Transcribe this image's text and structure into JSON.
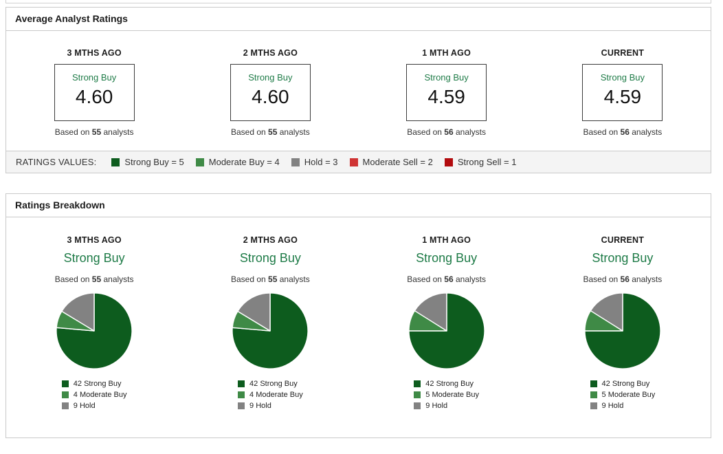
{
  "colors": {
    "strong_buy": "#0d5c1e",
    "moderate_buy": "#3f8a46",
    "hold": "#828282",
    "moderate_sell": "#cf3434",
    "strong_sell": "#b20b0e",
    "consensus_text": "#1e7b47",
    "panel_border": "#c9c9c9",
    "legend_strip_bg": "#f4f4f4"
  },
  "average_ratings": {
    "title": "Average Analyst Ratings",
    "based_prefix": "Based on",
    "based_suffix": "analysts",
    "columns": [
      {
        "period": "3 MTHS AGO",
        "consensus": "Strong Buy",
        "value": "4.60",
        "analysts": "55"
      },
      {
        "period": "2 MTHS AGO",
        "consensus": "Strong Buy",
        "value": "4.60",
        "analysts": "55"
      },
      {
        "period": "1 MTH AGO",
        "consensus": "Strong Buy",
        "value": "4.59",
        "analysts": "56"
      },
      {
        "period": "CURRENT",
        "consensus": "Strong Buy",
        "value": "4.59",
        "analysts": "56"
      }
    ],
    "ratings_values": {
      "label": "RATINGS VALUES:",
      "items": [
        {
          "label": "Strong Buy = 5",
          "color": "#0d5c1e"
        },
        {
          "label": "Moderate Buy = 4",
          "color": "#3f8a46"
        },
        {
          "label": "Hold = 3",
          "color": "#828282"
        },
        {
          "label": "Moderate Sell = 2",
          "color": "#cf3434"
        },
        {
          "label": "Strong Sell = 1",
          "color": "#b20b0e"
        }
      ]
    }
  },
  "ratings_breakdown": {
    "title": "Ratings Breakdown",
    "based_prefix": "Based on",
    "based_suffix": "analysts",
    "columns": [
      {
        "period": "3 MTHS AGO",
        "consensus": "Strong Buy",
        "analysts": "55",
        "legend": [
          {
            "text": "42 Strong Buy",
            "color": "#0d5c1e"
          },
          {
            "text": "4 Moderate Buy",
            "color": "#3f8a46"
          },
          {
            "text": "9 Hold",
            "color": "#828282"
          }
        ]
      },
      {
        "period": "2 MTHS AGO",
        "consensus": "Strong Buy",
        "analysts": "55",
        "legend": [
          {
            "text": "42 Strong Buy",
            "color": "#0d5c1e"
          },
          {
            "text": "4 Moderate Buy",
            "color": "#3f8a46"
          },
          {
            "text": "9 Hold",
            "color": "#828282"
          }
        ]
      },
      {
        "period": "1 MTH AGO",
        "consensus": "Strong Buy",
        "analysts": "56",
        "legend": [
          {
            "text": "42 Strong Buy",
            "color": "#0d5c1e"
          },
          {
            "text": "5 Moderate Buy",
            "color": "#3f8a46"
          },
          {
            "text": "9 Hold",
            "color": "#828282"
          }
        ]
      },
      {
        "period": "CURRENT",
        "consensus": "Strong Buy",
        "analysts": "56",
        "legend": [
          {
            "text": "42 Strong Buy",
            "color": "#0d5c1e"
          },
          {
            "text": "5 Moderate Buy",
            "color": "#3f8a46"
          },
          {
            "text": "9 Hold",
            "color": "#828282"
          }
        ]
      }
    ]
  },
  "chart_data": [
    {
      "type": "pie",
      "title": "3 MTHS AGO",
      "consensus": "Strong Buy",
      "total_analysts": 55,
      "labels": [
        "Strong Buy",
        "Moderate Buy",
        "Hold"
      ],
      "values": [
        42,
        4,
        9
      ],
      "colors": [
        "#0d5c1e",
        "#3f8a46",
        "#828282"
      ],
      "start_angle_deg": 0,
      "direction": "clockwise",
      "legend_position": "bottom"
    },
    {
      "type": "pie",
      "title": "2 MTHS AGO",
      "consensus": "Strong Buy",
      "total_analysts": 55,
      "labels": [
        "Strong Buy",
        "Moderate Buy",
        "Hold"
      ],
      "values": [
        42,
        4,
        9
      ],
      "colors": [
        "#0d5c1e",
        "#3f8a46",
        "#828282"
      ],
      "start_angle_deg": 0,
      "direction": "clockwise",
      "legend_position": "bottom"
    },
    {
      "type": "pie",
      "title": "1 MTH AGO",
      "consensus": "Strong Buy",
      "total_analysts": 56,
      "labels": [
        "Strong Buy",
        "Moderate Buy",
        "Hold"
      ],
      "values": [
        42,
        5,
        9
      ],
      "colors": [
        "#0d5c1e",
        "#3f8a46",
        "#828282"
      ],
      "start_angle_deg": 0,
      "direction": "clockwise",
      "legend_position": "bottom"
    },
    {
      "type": "pie",
      "title": "CURRENT",
      "consensus": "Strong Buy",
      "total_analysts": 56,
      "labels": [
        "Strong Buy",
        "Moderate Buy",
        "Hold"
      ],
      "values": [
        42,
        5,
        9
      ],
      "colors": [
        "#0d5c1e",
        "#3f8a46",
        "#828282"
      ],
      "start_angle_deg": 0,
      "direction": "clockwise",
      "legend_position": "bottom"
    }
  ]
}
